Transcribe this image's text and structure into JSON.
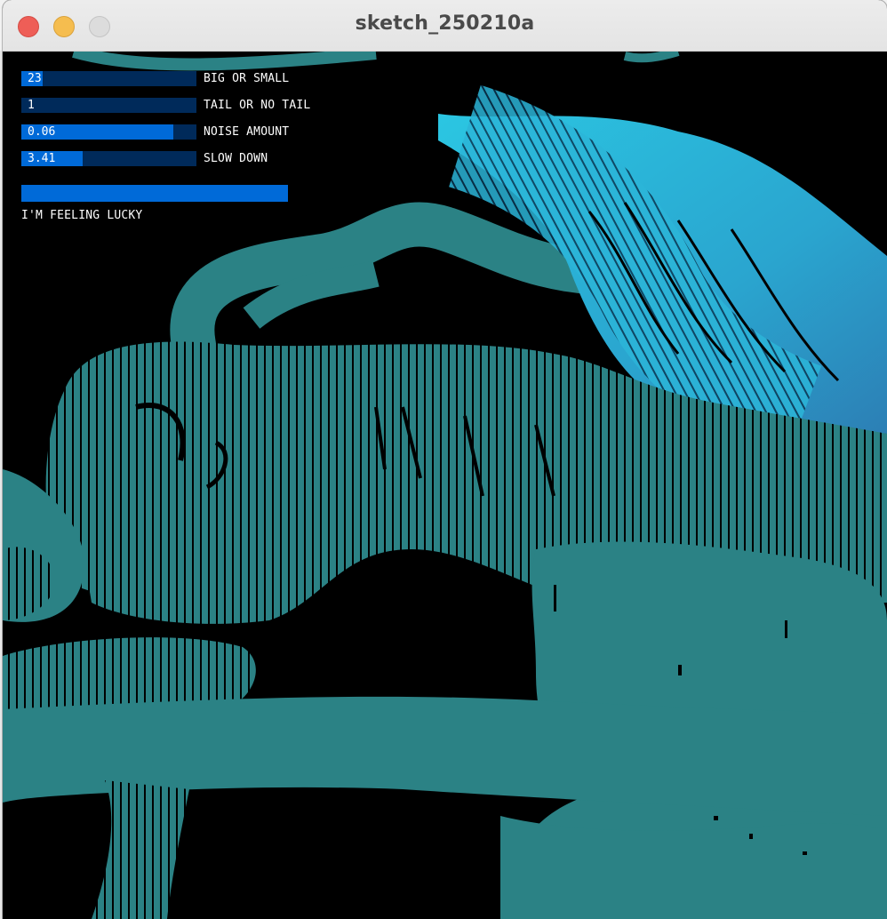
{
  "window": {
    "title": "sketch_250210a",
    "buttons": [
      "close",
      "minimize",
      "zoom"
    ]
  },
  "controls": {
    "sliders": [
      {
        "id": "big-or-small",
        "label": "BIG OR SMALL",
        "value_text": "23",
        "fill_fraction": 0.12
      },
      {
        "id": "tail-or-no-tail",
        "label": "TAIL OR NO TAIL",
        "value_text": "1",
        "fill_fraction": 0.0
      },
      {
        "id": "noise-amount",
        "label": "NOISE AMOUNT",
        "value_text": "0.06",
        "fill_fraction": 0.87
      },
      {
        "id": "slow-down",
        "label": "SLOW DOWN",
        "value_text": "3.41",
        "fill_fraction": 0.35
      }
    ],
    "button": {
      "label": "I'M FEELING LUCKY"
    }
  },
  "colors": {
    "background": "#000000",
    "tube": "#2b8285",
    "tube_highlight": "#2bb5d8",
    "slider_bg": "#002a5a",
    "slider_fill": "#006ad8",
    "label": "#ffffff"
  }
}
